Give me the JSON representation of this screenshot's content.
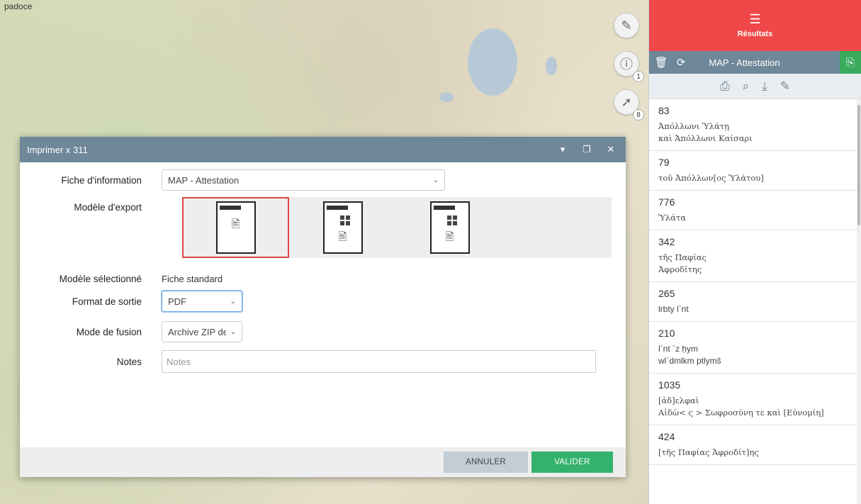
{
  "map": {
    "label": "padoce",
    "tools": [
      {
        "icon": "draw-tools-icon",
        "glyph": "✎",
        "count": ""
      },
      {
        "icon": "info-pointer-icon",
        "glyph": "ⓘ",
        "count": "1"
      },
      {
        "icon": "select-pointer-icon",
        "glyph": "➚",
        "count": "8"
      }
    ]
  },
  "results_panel": {
    "header_label": "Résultats",
    "layer_title": "MAP - Attestation",
    "items": [
      {
        "num": "83",
        "lines": [
          "Ἀπόλλωνι Ὑλάτῃ",
          "καὶ Ἀπόλλωνι Καίσαρι"
        ]
      },
      {
        "num": "79",
        "lines": [
          "τοῦ Ἀπόλλων[ος Ὑλάτου]"
        ]
      },
      {
        "num": "776",
        "lines": [
          "Ὑλάτα"
        ]
      },
      {
        "num": "342",
        "lines": [
          "τῆς Παφίας",
          "Ἀφροδίτης"
        ]
      },
      {
        "num": "265",
        "lines": [
          "lrbty l`nt"
        ]
      },
      {
        "num": "210",
        "lines": [
          "l`nt `z ḥym",
          "wl`dmlkm ptlymš"
        ]
      },
      {
        "num": "1035",
        "lines": [
          "[ἀδ]ελφαὶ",
          "Αἰδὼ< ς > Σωφροσύνη τε καὶ [Εὐνομίη]"
        ]
      },
      {
        "num": "424",
        "lines": [
          "[τῆς Παφίας Ἀφροδίτ]ης"
        ]
      }
    ]
  },
  "dialog": {
    "title": "Imprimer x 311",
    "fields": {
      "fiche_label": "Fiche d'information",
      "fiche_value": "MAP - Attestation",
      "modele_label": "Modèle d'export",
      "modele_selected_label": "Modèle sélectionné",
      "modele_selected_value": "Fiche standard",
      "format_label": "Format de sortie",
      "format_value": "PDF",
      "fusion_label": "Mode de fusion",
      "fusion_value": "Archive ZIP de",
      "notes_label": "Notes",
      "notes_placeholder": "Notes"
    },
    "buttons": {
      "cancel": "ANNULER",
      "ok": "VALIDER"
    }
  }
}
